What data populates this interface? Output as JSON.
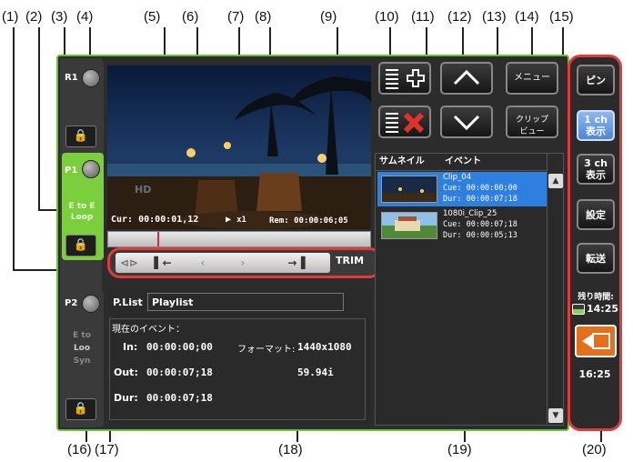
{
  "callouts": {
    "c1": "(1)",
    "c2": "(2)",
    "c3": "(3)",
    "c4": "(4)",
    "c5": "(5)",
    "c6": "(6)",
    "c7": "(7)",
    "c8": "(8)",
    "c9": "(9)",
    "c10": "(10)",
    "c11": "(11)",
    "c12": "(12)",
    "c13": "(13)",
    "c14": "(14)",
    "c15": "(15)",
    "c16": "(16)",
    "c17": "(17)",
    "c18": "(18)",
    "c19": "(19)",
    "c20": "(20)"
  },
  "channels": {
    "r1": {
      "label": "R1"
    },
    "p1": {
      "label": "P1",
      "mode_line1": "E to E",
      "mode_line2": "Loop"
    },
    "p2": {
      "label": "P2",
      "mode_line1": "E to",
      "mode_line2": "Loo",
      "mode_line3": "Syn"
    }
  },
  "preview": {
    "cur_label": "Cur:",
    "cur_time": "00:00:01,12",
    "speed": "x1",
    "rem_label": "Rem:",
    "rem_time": "00:00:06;05"
  },
  "trim": {
    "label": "TRIM"
  },
  "playlist": {
    "plist_label": "P.List",
    "plist_name": "Playlist",
    "current_event_label": "現在のイベント：",
    "in_label": "In:",
    "in_time": "00:00:00;00",
    "out_label": "Out:",
    "out_time": "00:00:07;18",
    "dur_label": "Dur:",
    "dur_time": "00:00:07;18",
    "format_label": "フォーマット:",
    "format_value": "1440x1080",
    "fps_value": "59.94i"
  },
  "buttons": {
    "menu": "メニュー",
    "clip_view_line1": "クリップ",
    "clip_view_line2": "ビュー"
  },
  "events": {
    "col_thumbnail": "サムネイル",
    "col_event": "イベント",
    "rows": [
      {
        "name": "Clip_04",
        "cue": "Cue: 00:00:00;00",
        "dur": "Dur: 00:00:07;18",
        "selected": true
      },
      {
        "name": "1080i_Clip_25",
        "cue": "Cue: 00:00:07;18",
        "dur": "Dur: 00:00:05;13",
        "selected": false
      }
    ]
  },
  "sidebar": {
    "pin": "ピン",
    "ch1_line1": "1 ch",
    "ch1_line2": "表示",
    "ch3_line1": "3 ch",
    "ch3_line2": "表示",
    "settings": "設定",
    "transfer": "転送",
    "remaining_label": "残り時間:",
    "remaining_time": "14:25",
    "clock": "16:25"
  },
  "colors": {
    "accent_green": "#6bbf3a",
    "callout_red": "#e23a3a",
    "selected_blue": "#2f7fe0"
  }
}
